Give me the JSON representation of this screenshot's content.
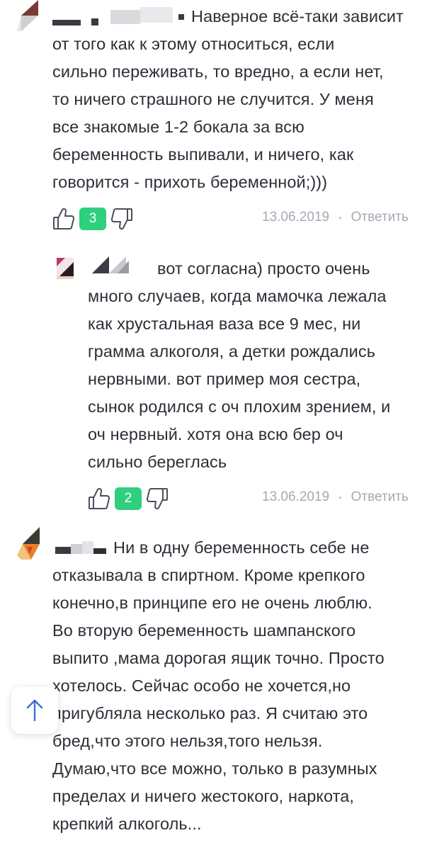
{
  "colors": {
    "accent_green": "#2ecf7e",
    "text": "#2e2e38",
    "muted": "#a4a9b3",
    "icon_stroke": "#4a4f5c"
  },
  "comments": [
    {
      "text": "Наверное всё-таки зависит\nот того как к этому относиться, если\nсильно переживать, то вредно, а если нет,\nто ничего страшного не случится. У меня\nвсе знакомые 1-2 бокала за всю\nбеременность выпивали, и ничего, как\nговорится - прихоть беременной;)))",
      "likes": "3",
      "date": "13.06.2019",
      "reply_label": "Ответить"
    },
    {
      "text": "вот согласна) просто очень\nмного случаев, когда мамочка лежала\nкак хрустальная ваза все 9 мес, ни\nграмма алкоголя, а детки рождались\nнервными. вот пример моя сестра,\nсынок родился с оч плохим зрением, и\nоч нервный. хотя она всю бер оч\nсильно береглась",
      "likes": "2",
      "date": "13.06.2019",
      "reply_label": "Ответить"
    },
    {
      "text": "Ни в одну беременность себе не\nотказывала в спиртном. Кроме крепкого\nконечно,в принципе его не очень люблю.\nВо вторую беременность шампанского\nвыпито ,мама дорогая ящик точно. Просто\nхотелось. Сейчас особо не хочется,но\nпригубляла несколько раз. Я считаю это\nбред,что этого нельзя,того нельзя.\nДумаю,что все можно, только в разумных\nпределах и ничего жестокого, наркота,\nкрепкий алкоголь..."
    }
  ],
  "icons": {
    "like": "thumbs-up-icon",
    "dislike": "thumbs-down-icon",
    "scroll_top": "arrow-up-icon"
  }
}
